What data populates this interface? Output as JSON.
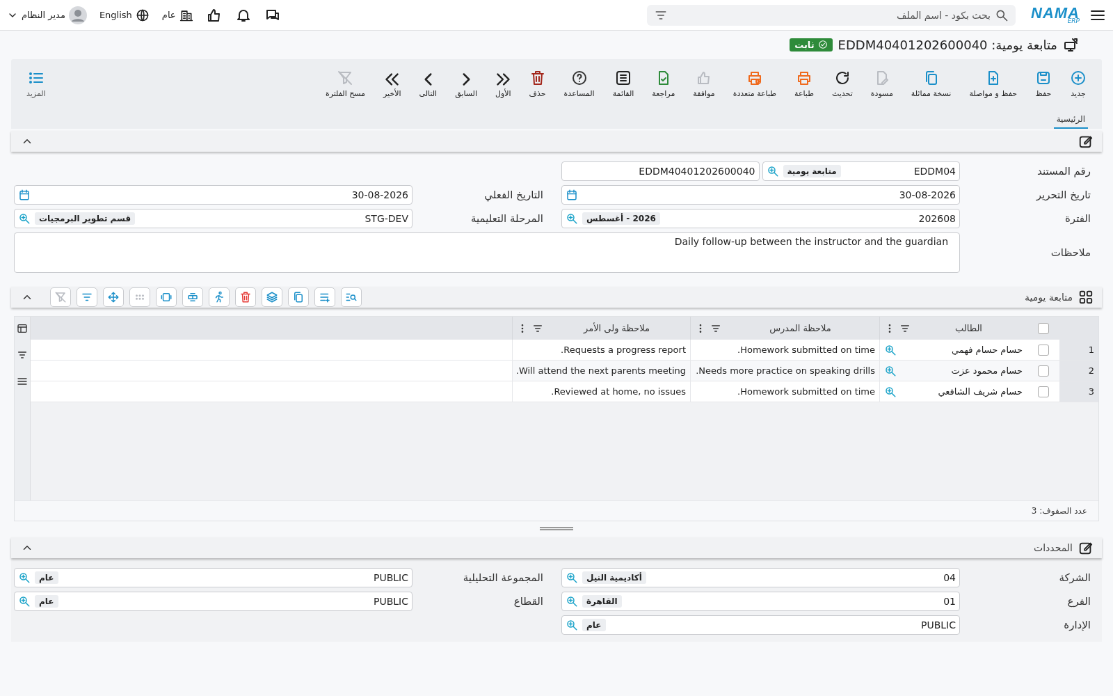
{
  "topbar": {
    "logo": "NAMA",
    "logo_sub": "ERP",
    "search": {
      "placeholder": "بحث بكود - اسم الملف"
    },
    "company": "عام",
    "language": "English",
    "user": "مدير النظام"
  },
  "title": {
    "text": "متابعة يومية: EDDM40401202600040",
    "status": "ثابت"
  },
  "toolbar": [
    {
      "label": "جديد",
      "color": "#1a8fc9",
      "disabled": false
    },
    {
      "label": "حفظ",
      "color": "#1a8fc9",
      "disabled": false
    },
    {
      "label": "حفظ و مواصلة",
      "color": "#1a8fc9",
      "disabled": false
    },
    {
      "label": "نسخة مماثلة",
      "color": "#1a8fc9",
      "disabled": false
    },
    {
      "label": "مسودة",
      "disabled": true
    },
    {
      "label": "تحديث",
      "color": "#222222",
      "disabled": false
    },
    {
      "label": "طباعة",
      "color": "#f06a1d",
      "disabled": false
    },
    {
      "label": "طباعة متعددة",
      "color": "#f06a1d",
      "disabled": false
    },
    {
      "label": "موافقة",
      "disabled": true
    },
    {
      "label": "مراجعة",
      "color": "#2e8b3a",
      "disabled": false
    },
    {
      "label": "القائمة",
      "color": "#222222",
      "disabled": false
    },
    {
      "label": "المساعدة",
      "color": "#333333",
      "disabled": false
    },
    {
      "label": "حذف",
      "color": "#a3271c",
      "disabled": false
    },
    {
      "label": "الأول",
      "color": "#222222",
      "disabled": false
    },
    {
      "label": "السابق",
      "color": "#222222",
      "disabled": false
    },
    {
      "label": "التالى",
      "color": "#222222",
      "disabled": false
    },
    {
      "label": "الأخير",
      "color": "#222222",
      "disabled": false
    },
    {
      "label": "مسح الفلترة",
      "disabled": true
    }
  ],
  "more": {
    "label": "المزيد"
  },
  "tabs": [
    {
      "label": "الرئيسية",
      "selected": true
    }
  ],
  "main_section": {
    "expanded": true,
    "rows": [
      [
        {
          "kind": "pair",
          "label": "رقم المستند",
          "value": "EDDM04",
          "tag": "متابعة يومية",
          "value2": "EDDM40401202600040"
        }
      ],
      [
        {
          "kind": "date",
          "label": "تاريخ التحرير",
          "value": "30-08-2026"
        },
        {
          "kind": "date",
          "label": "التاريخ الفعلي",
          "value": "30-08-2026"
        }
      ],
      [
        {
          "kind": "lookup",
          "label": "الفترة",
          "value": "202608",
          "tag": "2026 - أغسطس"
        },
        {
          "kind": "lookup",
          "label": "المرحلة التعليمية",
          "value": "STG-DEV",
          "tag": "قسم تطوير البرمجيات"
        }
      ],
      [
        {
          "kind": "textarea",
          "label": "ملاحظات",
          "value": "Daily follow-up between the instructor and the guardian"
        }
      ]
    ]
  },
  "grid": {
    "title": "متابعة يومية",
    "expanded": true,
    "tools": [
      {
        "color": "#1a8fc9",
        "disabled": false
      },
      {
        "color": "#1a8fc9",
        "disabled": false
      },
      {
        "color": "#1a8fc9",
        "disabled": false
      },
      {
        "color": "#1a8fc9",
        "disabled": false
      },
      {
        "color": "#e53935",
        "disabled": false
      },
      {
        "color": "#1a8fc9",
        "disabled": false
      },
      {
        "color": "#1a8fc9",
        "disabled": false
      },
      {
        "color": "#1a8fc9",
        "disabled": false
      },
      {
        "disabled": true
      },
      {
        "color": "#1a8fc9",
        "disabled": false
      },
      {
        "color": "#1a8fc9",
        "disabled": false
      },
      {
        "disabled": true
      }
    ],
    "all_checked": false,
    "columns": [
      "الطالب",
      "ملاحظة المدرس",
      "ملاحظة ولى الأمر"
    ],
    "rows": [
      {
        "number": "1",
        "checked": false,
        "student": "حسام حسام فهمي",
        "teacher_note": "Homework submitted on time.",
        "parent_note": "Requests a progress report."
      },
      {
        "number": "2",
        "checked": false,
        "student": "حسام محمود عزت",
        "teacher_note": "Needs more practice on speaking drills.",
        "parent_note": "Will attend the next parents meeting."
      },
      {
        "number": "3",
        "checked": false,
        "student": "حسام شريف الشافعي",
        "teacher_note": "Homework submitted on time.",
        "parent_note": "Reviewed at home, no issues."
      }
    ],
    "row_count": "عدد الصفوف: 3"
  },
  "dims_section": {
    "title": "المحددات",
    "expanded": true,
    "rows": [
      [
        {
          "kind": "lookup",
          "label": "الشركة",
          "value": "04",
          "tag": "أكاديمية النيل"
        },
        {
          "kind": "lookup",
          "label": "المجموعة التحليلية",
          "value": "PUBLIC",
          "tag": "عام"
        }
      ],
      [
        {
          "kind": "lookup",
          "label": "الفرع",
          "value": "01",
          "tag": "القاهرة"
        },
        {
          "kind": "lookup",
          "label": "القطاع",
          "value": "PUBLIC",
          "tag": "عام"
        }
      ],
      [
        {
          "kind": "lookup",
          "label": "الإدارة",
          "value": "PUBLIC",
          "tag": "عام"
        }
      ]
    ]
  }
}
